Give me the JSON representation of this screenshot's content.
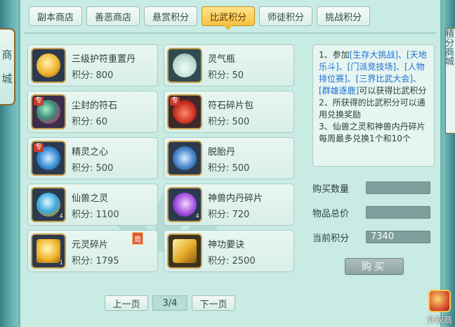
{
  "left_tab": {
    "label_chars": [
      "商",
      "城"
    ]
  },
  "right_tab": {
    "label": "積分商城"
  },
  "corner": {
    "label": "外观商"
  },
  "tabs": [
    "副本商店",
    "善恶商店",
    "悬赏积分",
    "比武积分",
    "师徒积分",
    "挑战积分"
  ],
  "active_tab_index": 3,
  "items": [
    {
      "name": "三级护符重置丹",
      "price": "积分: 800",
      "icon": "gold-amulet-icon",
      "zhuan": false,
      "qty": "",
      "weekly": false
    },
    {
      "name": "灵气瓶",
      "price": "积分: 50",
      "icon": "vase-icon",
      "zhuan": false,
      "qty": "",
      "weekly": false
    },
    {
      "name": "尘封的符石",
      "price": "积分: 60",
      "icon": "rune-stone-icon",
      "zhuan": true,
      "qty": "",
      "weekly": false
    },
    {
      "name": "符石碎片包",
      "price": "积分: 500",
      "icon": "red-pouch-icon",
      "zhuan": true,
      "qty": "",
      "weekly": false
    },
    {
      "name": "精灵之心",
      "price": "积分: 500",
      "icon": "spirit-heart-icon",
      "zhuan": true,
      "qty": "",
      "weekly": false
    },
    {
      "name": "脱胎丹",
      "price": "积分: 500",
      "icon": "gourd-icon",
      "zhuan": false,
      "qty": "",
      "weekly": false
    },
    {
      "name": "仙兽之灵",
      "price": "积分: 1100",
      "icon": "blue-orb-icon",
      "zhuan": false,
      "qty": "4",
      "weekly": false
    },
    {
      "name": "神兽内丹碎片",
      "price": "积分: 720",
      "icon": "purple-crystal-icon",
      "zhuan": false,
      "qty": "4",
      "weekly": false
    },
    {
      "name": "元灵碎片",
      "price": "积分: 1795",
      "icon": "gold-shard-icon",
      "zhuan": false,
      "qty": "1",
      "weekly": true
    },
    {
      "name": "神功要诀",
      "price": "积分: 2500",
      "icon": "gold-book-icon",
      "zhuan": false,
      "qty": "",
      "weekly": false
    }
  ],
  "zhuan_label": "专",
  "weekly_label": "周",
  "pager": {
    "prev": "上一页",
    "page": "3/4",
    "next": "下一页"
  },
  "info": {
    "l1a": "1、参加",
    "l1b": "[生存大挑战]、[天地乐斗]、[门派竞技场]、[人物排位赛]、[三界比武大会]、[群雄逐鹿]",
    "l1c": "可以获得比武积分",
    "l2": "2、所获得的比武积分可以通用兑换奖励",
    "l3": "3、仙兽之灵和神兽内丹碎片每周最多兑换1个和10个"
  },
  "form": {
    "qty_label": "购买数量",
    "qty_value": "",
    "total_label": "物品总价",
    "total_value": "",
    "current_label": "当前积分",
    "current_value": "7340"
  },
  "buy_label": "购买",
  "colors": {
    "accent": "#f7c240",
    "panel": "#c8ebe3",
    "link": "#1e6fd2"
  }
}
